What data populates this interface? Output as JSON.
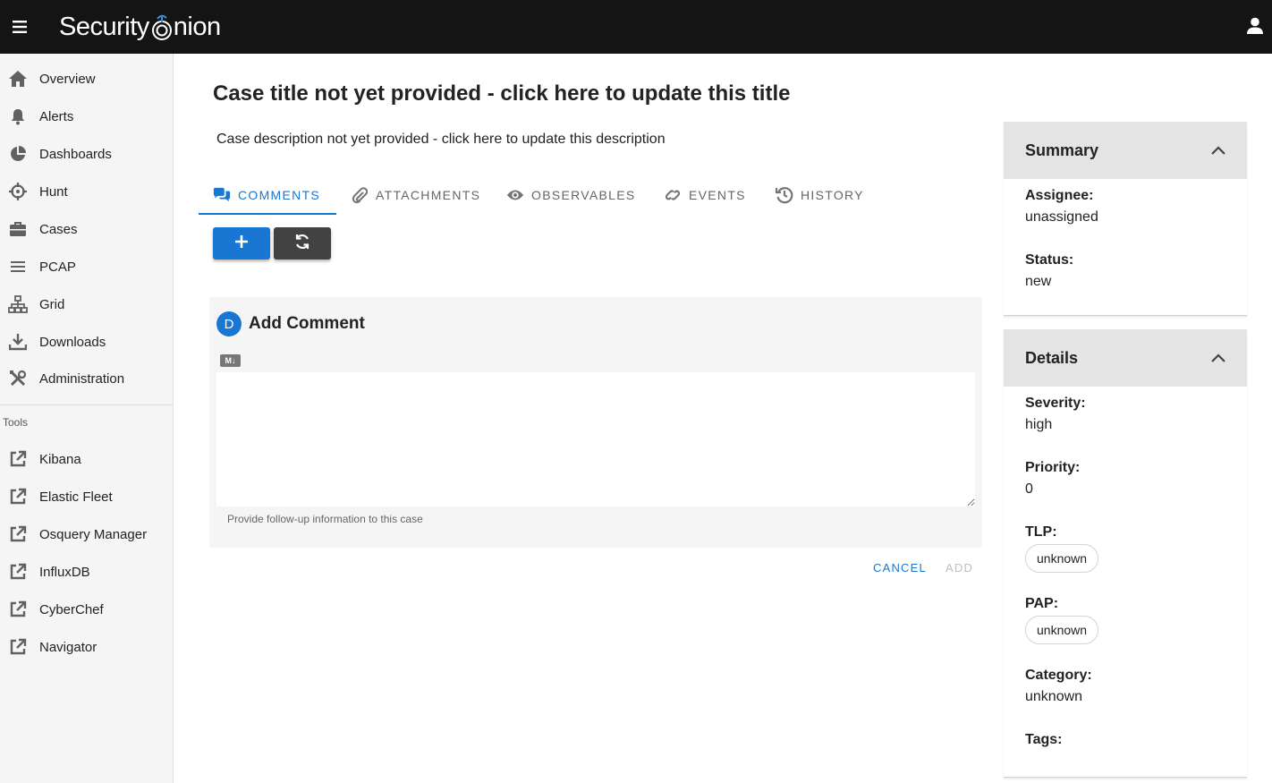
{
  "app": {
    "logo_text_1": "Security",
    "logo_text_2": "nion"
  },
  "sidebar": {
    "items": [
      {
        "label": "Overview",
        "icon": "home-icon"
      },
      {
        "label": "Alerts",
        "icon": "bell-icon"
      },
      {
        "label": "Dashboards",
        "icon": "pie-chart-icon"
      },
      {
        "label": "Hunt",
        "icon": "crosshairs-icon"
      },
      {
        "label": "Cases",
        "icon": "briefcase-icon"
      },
      {
        "label": "PCAP",
        "icon": "list-icon"
      },
      {
        "label": "Grid",
        "icon": "network-icon"
      },
      {
        "label": "Downloads",
        "icon": "download-icon"
      },
      {
        "label": "Administration",
        "icon": "tools-icon"
      }
    ],
    "tools_heading": "Tools",
    "tools": [
      {
        "label": "Kibana",
        "icon": "external-link-icon"
      },
      {
        "label": "Elastic Fleet",
        "icon": "external-link-icon"
      },
      {
        "label": "Osquery Manager",
        "icon": "external-link-icon"
      },
      {
        "label": "InfluxDB",
        "icon": "external-link-icon"
      },
      {
        "label": "CyberChef",
        "icon": "external-link-icon"
      },
      {
        "label": "Navigator",
        "icon": "external-link-icon"
      }
    ]
  },
  "case": {
    "title": "Case title not yet provided - click here to update this title",
    "description": "Case description not yet provided - click here to update this description"
  },
  "tabs": [
    {
      "label": "COMMENTS",
      "icon": "comments-icon",
      "active": true
    },
    {
      "label": "ATTACHMENTS",
      "icon": "paperclip-icon",
      "active": false
    },
    {
      "label": "OBSERVABLES",
      "icon": "eye-icon",
      "active": false
    },
    {
      "label": "EVENTS",
      "icon": "link-icon",
      "active": false
    },
    {
      "label": "HISTORY",
      "icon": "history-icon",
      "active": false
    }
  ],
  "comment": {
    "avatar_letter": "D",
    "title": "Add Comment",
    "markdown_badge": "M↓",
    "value": "",
    "hint": "Provide follow-up information to this case",
    "cancel_label": "CANCEL",
    "add_label": "ADD"
  },
  "summary": {
    "title": "Summary",
    "assignee_label": "Assignee:",
    "assignee_value": "unassigned",
    "status_label": "Status:",
    "status_value": "new"
  },
  "details": {
    "title": "Details",
    "severity_label": "Severity:",
    "severity_value": "high",
    "priority_label": "Priority:",
    "priority_value": "0",
    "tlp_label": "TLP:",
    "tlp_value": "unknown",
    "pap_label": "PAP:",
    "pap_value": "unknown",
    "category_label": "Category:",
    "category_value": "unknown",
    "tags_label": "Tags:"
  },
  "colors": {
    "accent": "#1976d2",
    "topbar": "#141414",
    "secondary_button": "#424242"
  }
}
